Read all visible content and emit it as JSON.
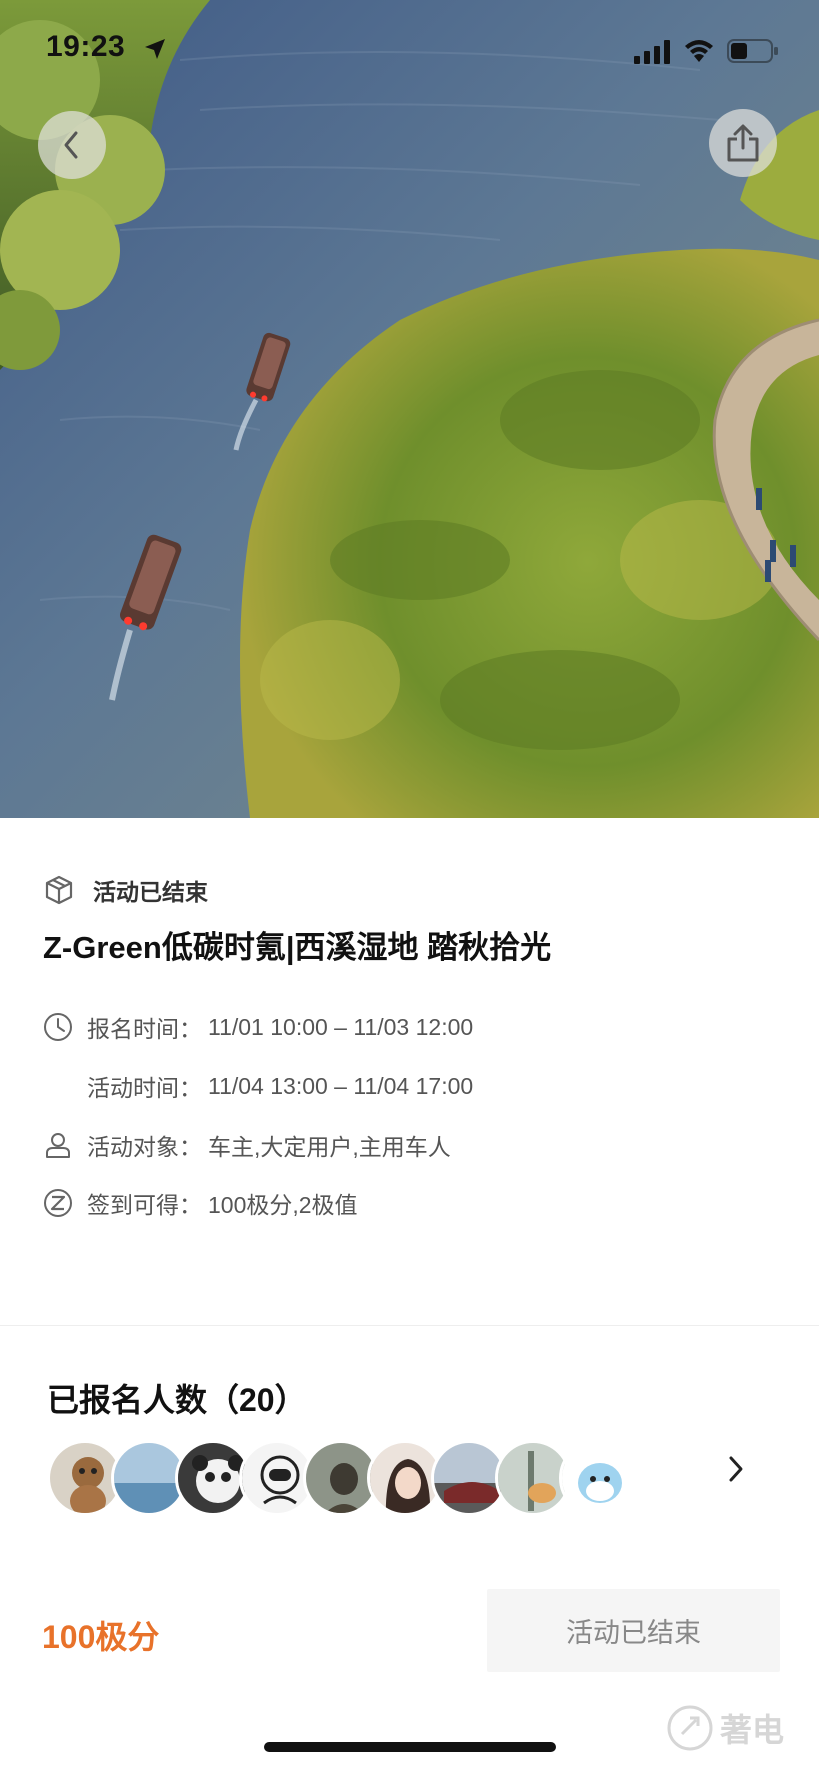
{
  "status_bar": {
    "time": "19:23"
  },
  "hero": {
    "icons": [
      "back-arrow-icon",
      "share-icon"
    ]
  },
  "activity": {
    "status": "活动已结束",
    "title": "Z-Green低碳时氪|西溪湿地 踏秋拾光",
    "signup_label": "报名时间：",
    "signup_value": "11/01 10:00 – 11/03 12:00",
    "activity_label": "活动时间：",
    "activity_value": "11/04 13:00 – 11/04 17:00",
    "target_label": "活动对象：",
    "target_value": "车主,大定用户,主用车人",
    "reward_label": "签到可得：",
    "reward_value": "100极分,2极值"
  },
  "participants": {
    "title": "已报名人数（20）",
    "avatar_count_shown": 9
  },
  "footer": {
    "points": "100极分",
    "button_label": "活动已结束"
  },
  "watermark": {
    "text": "著电"
  },
  "colors": {
    "accent": "#e8722a",
    "button_bg": "#f5f5f5",
    "button_text": "#888888"
  }
}
